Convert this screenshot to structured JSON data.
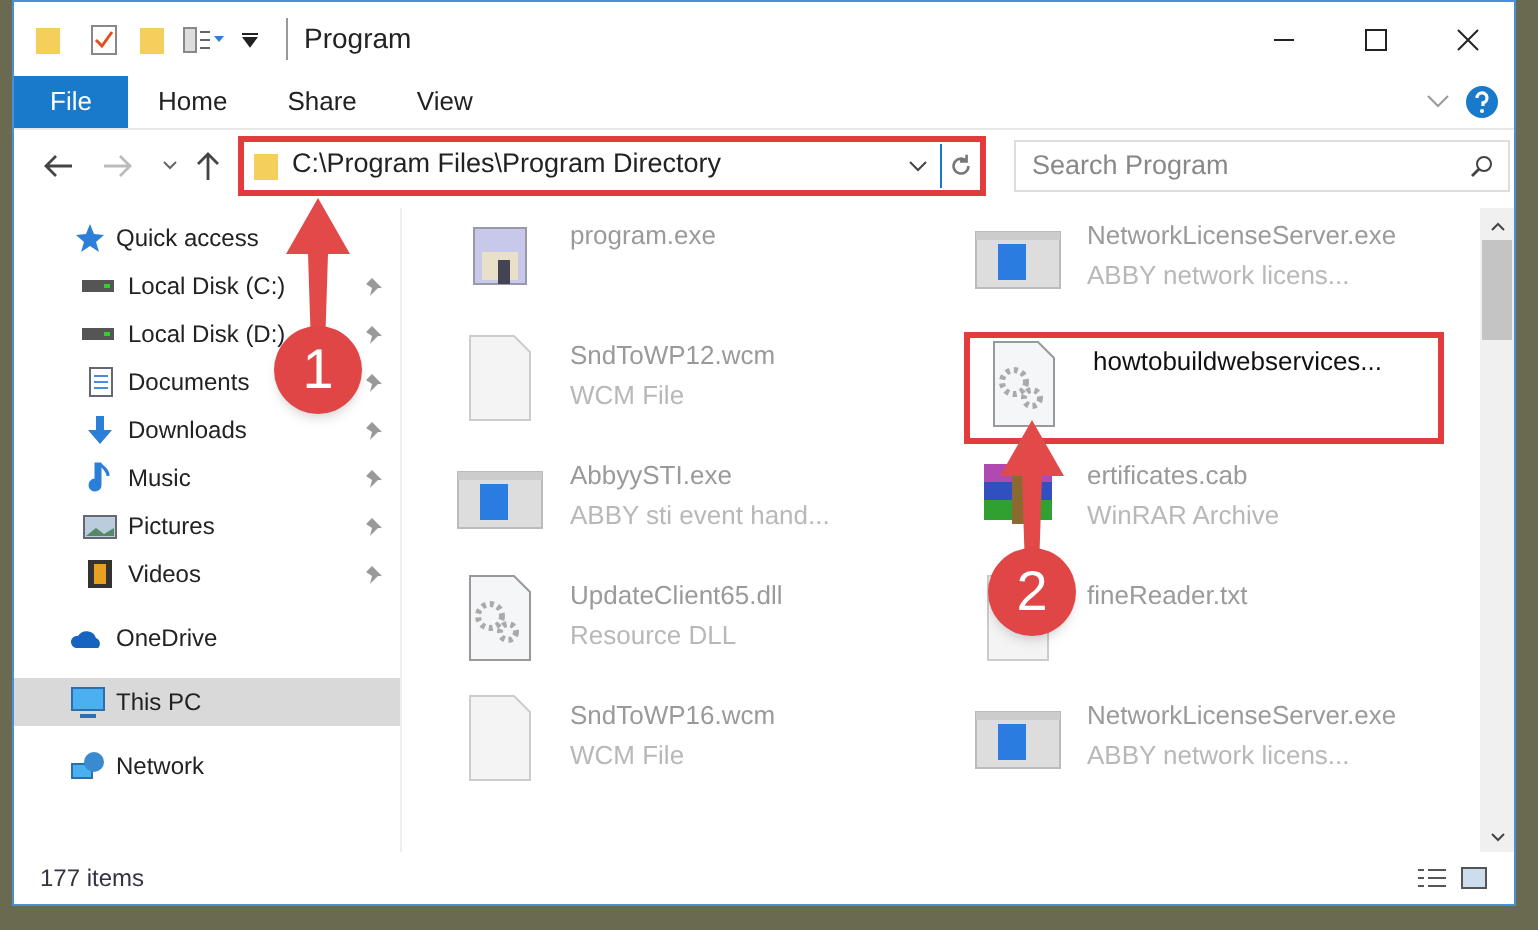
{
  "window": {
    "title": "Program"
  },
  "ribbon_tabs": [
    {
      "label": "File",
      "kind": "file"
    },
    {
      "label": "Home",
      "kind": "tab"
    },
    {
      "label": "Share",
      "kind": "tab"
    },
    {
      "label": "View",
      "kind": "tab"
    }
  ],
  "address": {
    "path": "C:\\Program Files\\Program Directory",
    "highlighted": true
  },
  "search": {
    "placeholder": "Search Program"
  },
  "sidebar": {
    "items": [
      {
        "label": "Quick access",
        "kind": "star",
        "selected": false,
        "children": [
          {
            "label": "Local Disk (C:)",
            "kind": "disk",
            "pinned": true,
            "selected": false
          },
          {
            "label": "Local Disk (D:)",
            "kind": "disk",
            "pinned": true,
            "selected": false
          },
          {
            "label": "Documents",
            "kind": "document",
            "pinned": true,
            "selected": false
          },
          {
            "label": "Downloads",
            "kind": "download",
            "pinned": true,
            "selected": false
          },
          {
            "label": "Music",
            "kind": "music",
            "pinned": true,
            "selected": false
          },
          {
            "label": "Pictures",
            "kind": "picture",
            "pinned": true,
            "selected": false
          },
          {
            "label": "Videos",
            "kind": "video",
            "pinned": true,
            "selected": false
          }
        ]
      },
      {
        "label": "OneDrive",
        "kind": "cloud",
        "selected": false
      },
      {
        "label": "This PC",
        "kind": "pc",
        "selected": true
      },
      {
        "label": "Network",
        "kind": "network",
        "selected": false
      }
    ]
  },
  "files": [
    {
      "name": "program.exe",
      "kind": "exe",
      "highlighted": false
    },
    {
      "name": "NetworkLicenseServer.exe",
      "type": "ABBY network licens...",
      "kind": "window",
      "highlighted": false
    },
    {
      "name": "SndToWP12.wcm",
      "type": "WCM File",
      "kind": "blank",
      "highlighted": false
    },
    {
      "name": "howtobuildwebservices...",
      "kind": "gear",
      "highlighted": true
    },
    {
      "name": "AbbyySTI.exe",
      "type": "ABBY sti event hand...",
      "kind": "window",
      "highlighted": false
    },
    {
      "name": "ertificates.cab",
      "type": "WinRAR Archive",
      "kind": "archive",
      "highlighted": false
    },
    {
      "name": "UpdateClient65.dll",
      "type": "Resource DLL",
      "kind": "gear",
      "highlighted": false
    },
    {
      "name": "fineReader.txt",
      "kind": "blank",
      "highlighted": false
    },
    {
      "name": "SndToWP16.wcm",
      "type": "WCM File",
      "kind": "blank",
      "highlighted": false
    },
    {
      "name": "NetworkLicenseServer.exe",
      "type": "ABBY network licens...",
      "kind": "window",
      "highlighted": false
    }
  ],
  "annotations": [
    {
      "label": "1"
    },
    {
      "label": "2"
    }
  ],
  "status_bar": {
    "count": "177 items"
  }
}
